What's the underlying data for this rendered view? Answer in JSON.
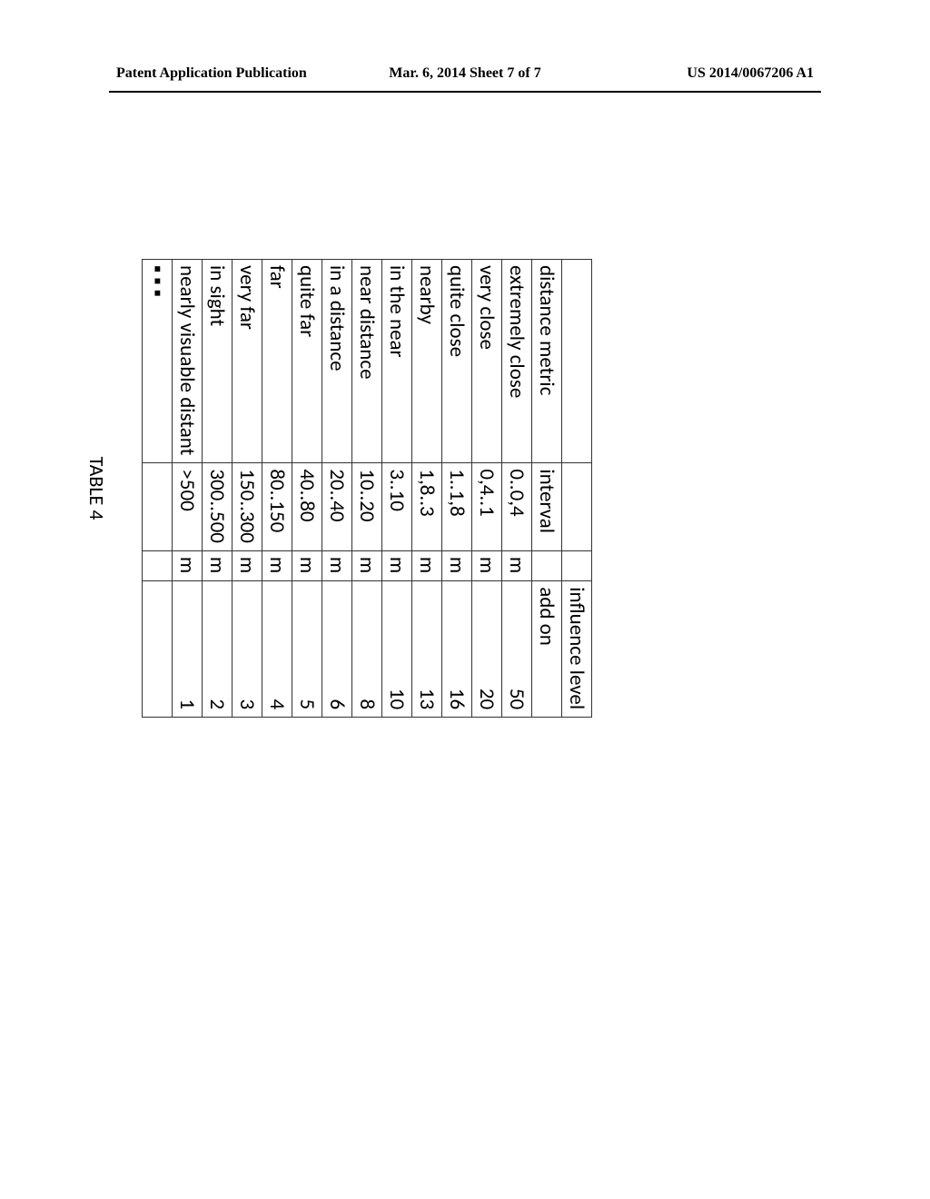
{
  "header": {
    "left": "Patent Application Publication",
    "center": "Mar. 6, 2014  Sheet 7 of 7",
    "right": "US 2014/0067206 A1"
  },
  "table": {
    "caption": "TABLE 4",
    "header_row1": {
      "metric": "",
      "interval": "",
      "unit": "",
      "influence": "influence level"
    },
    "header_row2": {
      "metric": "distance metric",
      "interval": "interval",
      "unit": "",
      "influence": "add on"
    },
    "rows": [
      {
        "metric": "extremely close",
        "interval": "0..0,4",
        "unit": "m",
        "influence": "50"
      },
      {
        "metric": "very close",
        "interval": "0,4..1",
        "unit": "m",
        "influence": "20"
      },
      {
        "metric": "quite close",
        "interval": "1..1,8",
        "unit": "m",
        "influence": "16"
      },
      {
        "metric": "nearby",
        "interval": "1,8..3",
        "unit": "m",
        "influence": "13"
      },
      {
        "metric": "in the near",
        "interval": "3..10",
        "unit": "m",
        "influence": "10"
      },
      {
        "metric": "near distance",
        "interval": "10..20",
        "unit": "m",
        "influence": "8"
      },
      {
        "metric": "in a distance",
        "interval": "20..40",
        "unit": "m",
        "influence": "6"
      },
      {
        "metric": "quite far",
        "interval": "40..80",
        "unit": "m",
        "influence": "5"
      },
      {
        "metric": "far",
        "interval": "80..150",
        "unit": "m",
        "influence": "4"
      },
      {
        "metric": "very far",
        "interval": "150..300",
        "unit": "m",
        "influence": "3"
      },
      {
        "metric": "in sight",
        "interval": "300..500",
        "unit": "m",
        "influence": "2"
      },
      {
        "metric": "nearly visuable distant",
        "interval": ">500",
        "unit": "m",
        "influence": "1"
      },
      {
        "metric": "▪ ▪ ▪",
        "interval": "",
        "unit": "",
        "influence": ""
      }
    ]
  },
  "chart_data": {
    "type": "table",
    "title": "TABLE 4",
    "columns": [
      "distance metric",
      "interval",
      "unit",
      "influence level add on"
    ],
    "rows": [
      [
        "extremely close",
        "0..0,4",
        "m",
        50
      ],
      [
        "very close",
        "0,4..1",
        "m",
        20
      ],
      [
        "quite close",
        "1..1,8",
        "m",
        16
      ],
      [
        "nearby",
        "1,8..3",
        "m",
        13
      ],
      [
        "in the near",
        "3..10",
        "m",
        10
      ],
      [
        "near distance",
        "10..20",
        "m",
        8
      ],
      [
        "in a distance",
        "20..40",
        "m",
        6
      ],
      [
        "quite far",
        "40..80",
        "m",
        5
      ],
      [
        "far",
        "80..150",
        "m",
        4
      ],
      [
        "very far",
        "150..300",
        "m",
        3
      ],
      [
        "in sight",
        "300..500",
        "m",
        2
      ],
      [
        "nearly visuable distant",
        ">500",
        "m",
        1
      ]
    ]
  }
}
